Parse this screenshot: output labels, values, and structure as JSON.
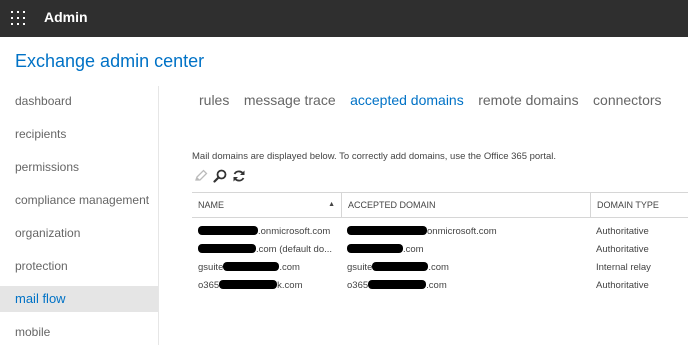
{
  "topbar": {
    "app_title": "Admin"
  },
  "page_title": "Exchange admin center",
  "nav": {
    "items": [
      {
        "label": "dashboard",
        "active": false
      },
      {
        "label": "recipients",
        "active": false
      },
      {
        "label": "permissions",
        "active": false
      },
      {
        "label": "compliance management",
        "active": false
      },
      {
        "label": "organization",
        "active": false
      },
      {
        "label": "protection",
        "active": false
      },
      {
        "label": "mail flow",
        "active": true
      },
      {
        "label": "mobile",
        "active": false
      }
    ]
  },
  "tabs": [
    {
      "label": "rules",
      "active": false
    },
    {
      "label": "message trace",
      "active": false
    },
    {
      "label": "accepted domains",
      "active": true
    },
    {
      "label": "remote domains",
      "active": false
    },
    {
      "label": "connectors",
      "active": false
    }
  ],
  "description": "Mail domains are displayed below. To correctly add domains, use the Office 365 portal.",
  "toolbar": {
    "edit_icon": "pencil-icon",
    "search_icon": "search-icon",
    "refresh_icon": "refresh-icon"
  },
  "table": {
    "columns": [
      "NAME",
      "ACCEPTED DOMAIN",
      "DOMAIN TYPE"
    ],
    "sort_indicator": "▲",
    "rows": [
      {
        "name_prefix": "",
        "name_suffix": ".onmicrosoft.com",
        "domain_prefix": "",
        "domain_suffix": "onmicrosoft.com",
        "type": "Authoritative"
      },
      {
        "name_prefix": "",
        "name_suffix": ".com (default do...",
        "domain_prefix": "",
        "domain_suffix": ".com",
        "type": "Authoritative"
      },
      {
        "name_prefix": "gsuite",
        "name_suffix": ".com",
        "domain_prefix": "gsuite",
        "domain_suffix": ".com",
        "type": "Internal relay"
      },
      {
        "name_prefix": "o365",
        "name_suffix": "k.com",
        "domain_prefix": "o365",
        "domain_suffix": ".com",
        "type": "Authoritative"
      }
    ]
  },
  "colors": {
    "accent": "#0072c6",
    "topbar": "#2f2f2f",
    "nav_active_bg": "#e5e5e5"
  }
}
